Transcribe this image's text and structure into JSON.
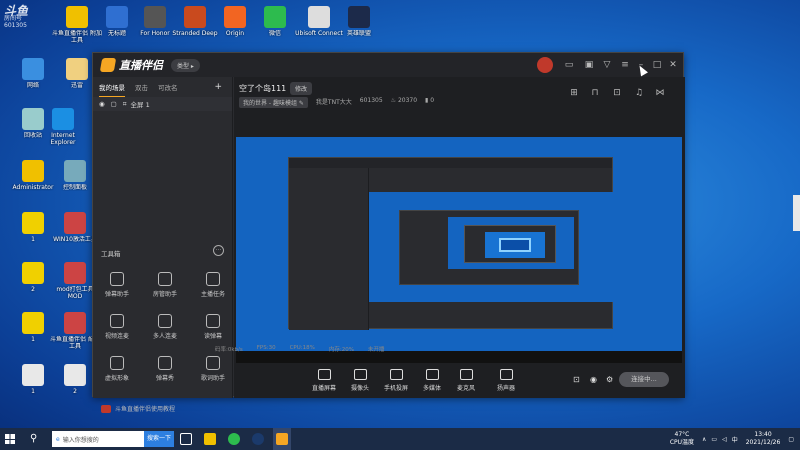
{
  "watermark": {
    "line1": "斗鱼",
    "line2": "房间号",
    "line3": "601305"
  },
  "desktop_icons": [
    {
      "label": "",
      "color": "#e8e8e8"
    },
    {
      "label": "斗鱼直播伴侣\n附加工具",
      "color": "#f0c000"
    },
    {
      "label": "无标题",
      "color": "#2f6fd1"
    },
    {
      "label": "For Honor",
      "color": "#555"
    },
    {
      "label": "Stranded Deep",
      "color": "#c94a1e"
    },
    {
      "label": "Origin",
      "color": "#f26522"
    },
    {
      "label": "微信",
      "color": "#2dbb4e"
    },
    {
      "label": "Ubisoft Connect",
      "color": "#ddd"
    },
    {
      "label": "英雄联盟",
      "color": "#1c2a4a"
    },
    {
      "label": "网络",
      "color": "#3a8fe0"
    },
    {
      "label": "迅雷",
      "color": "#f0d080"
    },
    {
      "label": "回收站",
      "color": "#9cc"
    },
    {
      "label": "Internet Explorer",
      "color": "#1b8fe3"
    },
    {
      "label": "Administrator",
      "color": "#f0c000"
    },
    {
      "label": "控制面板",
      "color": "#7ab"
    },
    {
      "label": "1",
      "color": "#f0d000"
    },
    {
      "label": "WIN10激活工具",
      "color": "#c44"
    },
    {
      "label": "2",
      "color": "#f0d000"
    },
    {
      "label": "mod打包工具 MOD",
      "color": "#c44"
    },
    {
      "label": "1",
      "color": "#f0d000"
    },
    {
      "label": "斗鱼直播伴侣 配置工具",
      "color": "#c44"
    },
    {
      "label": "1",
      "color": "#e8e8e8"
    },
    {
      "label": "2",
      "color": "#e8e8e8"
    }
  ],
  "app": {
    "logo_text": "直播伴侣",
    "pill": "类型",
    "sidebar_tabs": [
      "我的场景",
      "双击",
      "可改名"
    ],
    "add_icon": "+",
    "scene_label": "全屏 1",
    "tools_title": "工具箱",
    "tools": [
      {
        "label": "弹幕助手"
      },
      {
        "label": "房管助手"
      },
      {
        "label": "主播任务"
      },
      {
        "label": "视频连麦"
      },
      {
        "label": "多人连麦"
      },
      {
        "label": "读弹幕"
      },
      {
        "label": "虚拟形象"
      },
      {
        "label": "弹幕秀"
      },
      {
        "label": "歌词助手"
      }
    ],
    "tip": "斗鱼直播伴侣使用教程",
    "room_title": "空了个岛111",
    "modify": "修改",
    "category": "我的世界 - 趣味模组",
    "streamer": "我是TNT大大",
    "room_id": "601305",
    "fans": "20370",
    "online": "0",
    "bottom_buttons": [
      {
        "label": "直播屏幕"
      },
      {
        "label": "摄像头"
      },
      {
        "label": "手机投屏"
      },
      {
        "label": "多媒体"
      },
      {
        "label": "麦克风"
      },
      {
        "label": "扬声器"
      }
    ],
    "go_live": "连接中...",
    "stats": {
      "bitrate": "码率:0kb/s",
      "fps": "FPS:30",
      "cpu": "CPU:18%",
      "mem": "内存:20%",
      "status": "未开播"
    }
  },
  "taskbar": {
    "search_placeholder": "输入你想搜的",
    "search_button": "搜索一下",
    "temp": "47°C",
    "cpu_label": "CPU温度",
    "time": "13:40",
    "date": "2021/12/26",
    "lang": "中"
  },
  "colors": {
    "accent": "#f5a623",
    "app_bg": "#2a2b2f",
    "taskbar": "#1b2b46"
  }
}
